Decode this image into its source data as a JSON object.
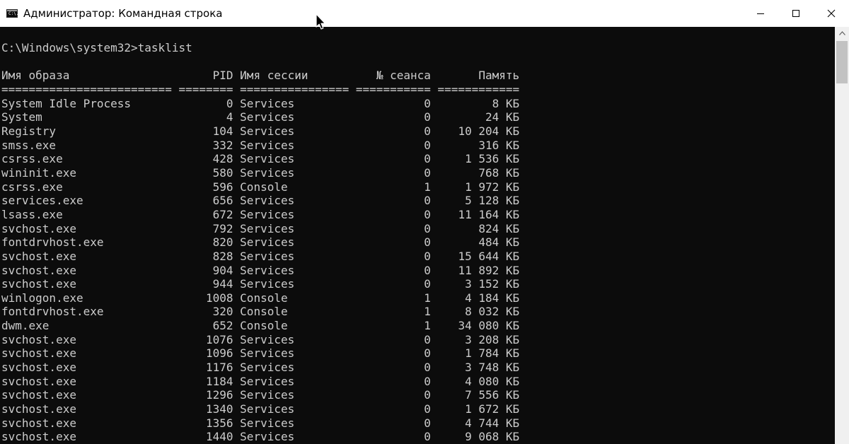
{
  "window": {
    "title": "Администратор: Командная строка",
    "icon_label": "C:\\.",
    "controls": [
      "minimize-icon",
      "maximize-icon",
      "close-icon"
    ]
  },
  "console": {
    "prompt": "C:\\Windows\\system32>tasklist",
    "columns": [
      "Имя образа",
      "PID",
      "Имя сессии",
      "№ сеанса",
      "Память"
    ],
    "rows": [
      [
        "System Idle Process",
        "0",
        "Services",
        "0",
        "8 КБ"
      ],
      [
        "System",
        "4",
        "Services",
        "0",
        "24 КБ"
      ],
      [
        "Registry",
        "104",
        "Services",
        "0",
        "10 204 КБ"
      ],
      [
        "smss.exe",
        "332",
        "Services",
        "0",
        "316 КБ"
      ],
      [
        "csrss.exe",
        "428",
        "Services",
        "0",
        "1 536 КБ"
      ],
      [
        "wininit.exe",
        "580",
        "Services",
        "0",
        "768 КБ"
      ],
      [
        "csrss.exe",
        "596",
        "Console",
        "1",
        "1 972 КБ"
      ],
      [
        "services.exe",
        "656",
        "Services",
        "0",
        "5 128 КБ"
      ],
      [
        "lsass.exe",
        "672",
        "Services",
        "0",
        "11 164 КБ"
      ],
      [
        "svchost.exe",
        "792",
        "Services",
        "0",
        "824 КБ"
      ],
      [
        "fontdrvhost.exe",
        "820",
        "Services",
        "0",
        "484 КБ"
      ],
      [
        "svchost.exe",
        "828",
        "Services",
        "0",
        "15 644 КБ"
      ],
      [
        "svchost.exe",
        "904",
        "Services",
        "0",
        "11 892 КБ"
      ],
      [
        "svchost.exe",
        "944",
        "Services",
        "0",
        "3 152 КБ"
      ],
      [
        "winlogon.exe",
        "1008",
        "Console",
        "1",
        "4 184 КБ"
      ],
      [
        "fontdrvhost.exe",
        "320",
        "Console",
        "1",
        "8 032 КБ"
      ],
      [
        "dwm.exe",
        "652",
        "Console",
        "1",
        "34 080 КБ"
      ],
      [
        "svchost.exe",
        "1076",
        "Services",
        "0",
        "3 208 КБ"
      ],
      [
        "svchost.exe",
        "1096",
        "Services",
        "0",
        "1 784 КБ"
      ],
      [
        "svchost.exe",
        "1176",
        "Services",
        "0",
        "3 748 КБ"
      ],
      [
        "svchost.exe",
        "1184",
        "Services",
        "0",
        "4 080 КБ"
      ],
      [
        "svchost.exe",
        "1296",
        "Services",
        "0",
        "7 556 КБ"
      ],
      [
        "svchost.exe",
        "1340",
        "Services",
        "0",
        "1 672 КБ"
      ],
      [
        "svchost.exe",
        "1356",
        "Services",
        "0",
        "4 744 КБ"
      ],
      [
        "svchost.exe",
        "1440",
        "Services",
        "0",
        "9 068 КБ"
      ]
    ]
  },
  "colors": {
    "console_background": "#0c0c0c",
    "console_text": "#cccccc",
    "titlebar_background": "#ffffff"
  }
}
